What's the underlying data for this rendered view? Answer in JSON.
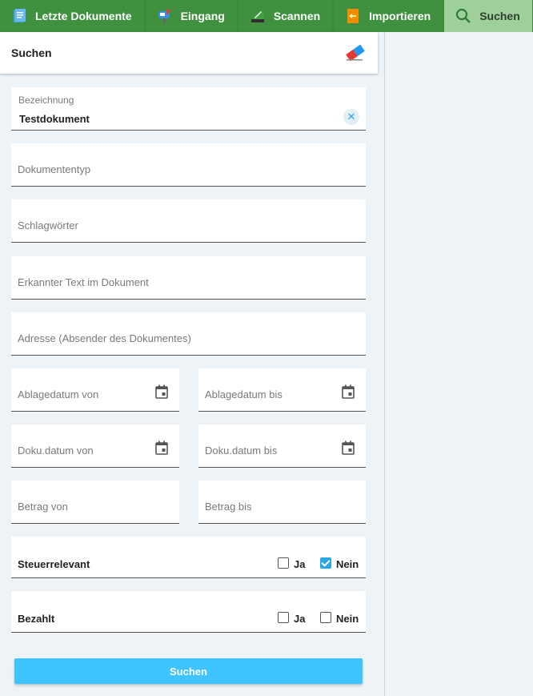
{
  "tabs": [
    {
      "label": "Letzte Dokumente",
      "icon": "document-icon"
    },
    {
      "label": "Eingang",
      "icon": "mailbox-icon"
    },
    {
      "label": "Scannen",
      "icon": "scanner-icon"
    },
    {
      "label": "Importieren",
      "icon": "import-icon"
    },
    {
      "label": "Suchen",
      "icon": "search-icon"
    }
  ],
  "panel": {
    "title": "Suchen"
  },
  "fields": {
    "bezeichnung": {
      "label": "Bezeichnung",
      "value": "Testdokument"
    },
    "dokumententyp": {
      "placeholder": "Dokumententyp"
    },
    "schlagwoerter": {
      "placeholder": "Schlagwörter"
    },
    "erkannter_text": {
      "placeholder": "Erkannter Text im Dokument"
    },
    "adresse": {
      "placeholder": "Adresse (Absender des Dokumentes)"
    },
    "ablagedatum_von": {
      "placeholder": "Ablagedatum von"
    },
    "ablagedatum_bis": {
      "placeholder": "Ablagedatum bis"
    },
    "dokudatum_von": {
      "placeholder": "Doku.datum von"
    },
    "dokudatum_bis": {
      "placeholder": "Doku.datum bis"
    },
    "betrag_von": {
      "placeholder": "Betrag von"
    },
    "betrag_bis": {
      "placeholder": "Betrag bis"
    }
  },
  "steuerrelevant": {
    "label": "Steuerrelevant",
    "ja": "Ja",
    "nein": "Nein",
    "ja_checked": false,
    "nein_checked": true
  },
  "bezahlt": {
    "label": "Bezahlt",
    "ja": "Ja",
    "nein": "Nein",
    "ja_checked": false,
    "nein_checked": false
  },
  "submit_label": "Suchen",
  "colors": {
    "tabbar": "#3a8a3a",
    "active_tab": "#9fcf9b",
    "accent": "#40c4ff",
    "checkbox": "#2aa6e0"
  }
}
